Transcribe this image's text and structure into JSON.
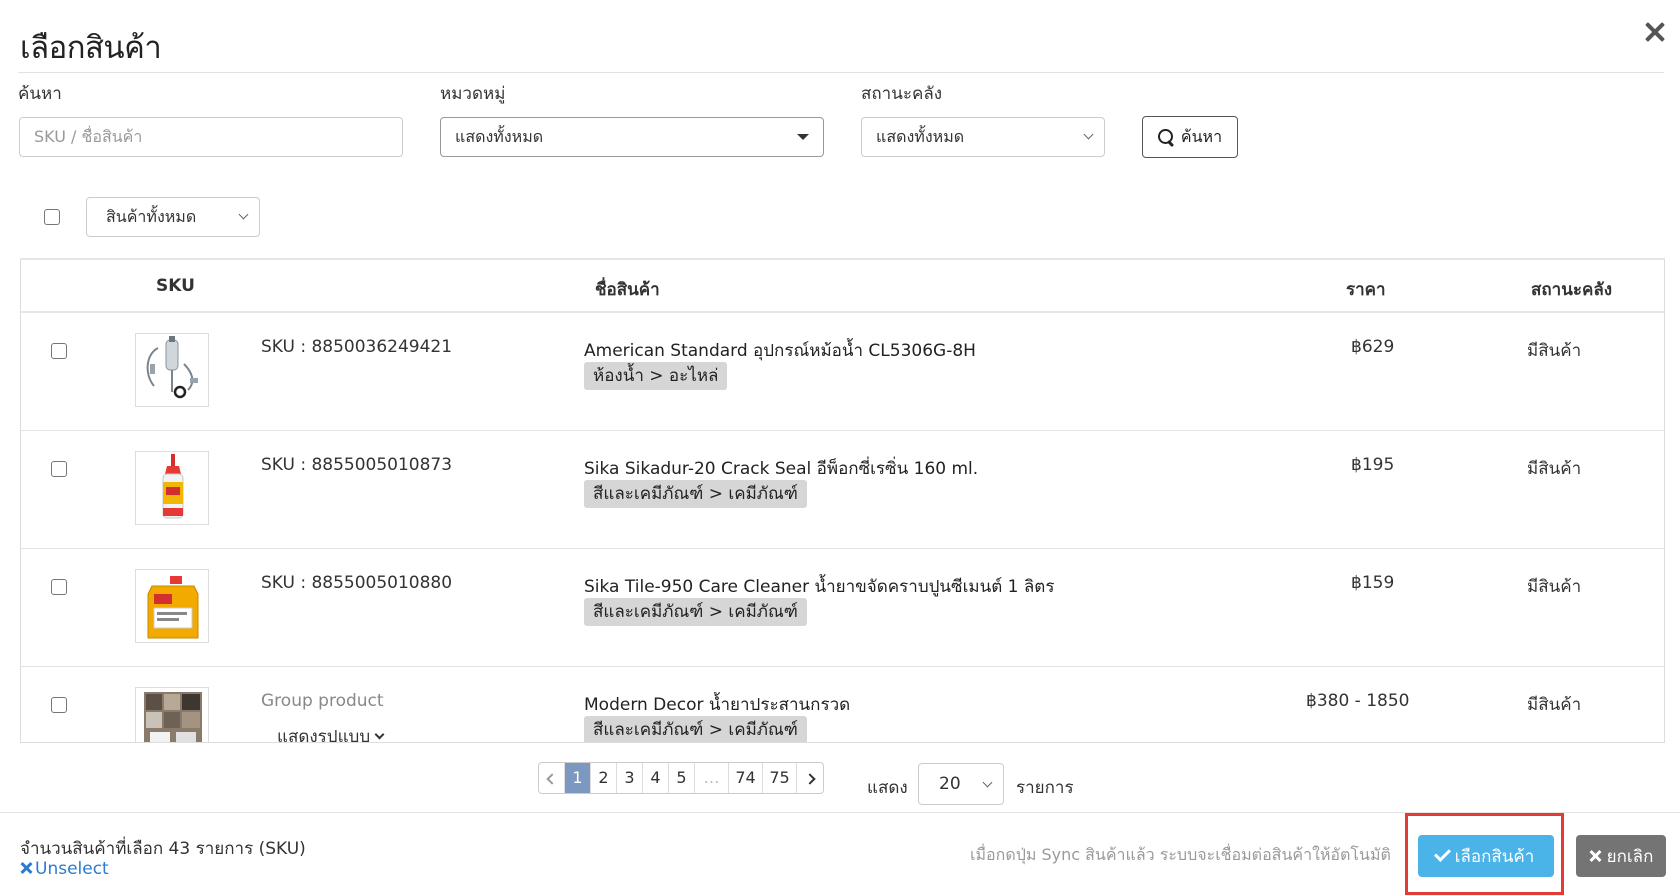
{
  "modal": {
    "title": "เลือกสินค้า"
  },
  "filters": {
    "search_label": "ค้นหา",
    "search_placeholder": "SKU / ชื่อสินค้า",
    "category_label": "หมวดหมู่",
    "category_value": "แสดงทั้งหมด",
    "stock_label": "สถานะคลัง",
    "stock_value": "แสดงทั้งหมด",
    "search_button": "ค้นหา"
  },
  "bulk": {
    "filter_value": "สินค้าทั้งหมด"
  },
  "table": {
    "headers": {
      "sku": "SKU",
      "name": "ชื่อสินค้า",
      "price": "ราคา",
      "stock": "สถานะคลัง"
    },
    "rows": [
      {
        "sku": "SKU : 8850036249421",
        "name": "American Standard อุปกรณ์หม้อน้ำ CL5306G-8H",
        "category": "ห้องน้ำ > อะไหล่",
        "price": "฿629",
        "stock": "มีสินค้า"
      },
      {
        "sku": "SKU : 8855005010873",
        "name": "Sika Sikadur-20 Crack Seal อีพ็อกซี่เรซิ่น 160 ml.",
        "category": "สีและเคมีภัณฑ์ > เคมีภัณฑ์",
        "price": "฿195",
        "stock": "มีสินค้า"
      },
      {
        "sku": "SKU : 8855005010880",
        "name": "Sika Tile-950 Care Cleaner น้ำยาขจัดคราบปูนซีเมนต์ 1 ลิตร",
        "category": "สีและเคมีภัณฑ์ > เคมีภัณฑ์",
        "price": "฿159",
        "stock": "มีสินค้า"
      },
      {
        "sku": "Group product",
        "variant_link": "แสดงรูปแบบ",
        "name": "Modern Decor น้ำยาประสานกรวด",
        "category": "สีและเคมีภัณฑ์ > เคมีภัณฑ์",
        "price": "฿380 - 1850",
        "stock": "มีสินค้า"
      }
    ]
  },
  "pagination": {
    "pages": [
      "1",
      "2",
      "3",
      "4",
      "5",
      "…",
      "74",
      "75"
    ],
    "current": "1",
    "show_label": "แสดง",
    "per_page": "20",
    "items_label": "รายการ"
  },
  "footer": {
    "selected_count": "จำนวนสินค้าที่เลือก 43 รายการ (SKU)",
    "unselect": "Unselect",
    "hint": "เมื่อกดปุ่ม Sync สินค้าแล้ว ระบบจะเชื่อมต่อสินค้าให้อัตโนมัติ",
    "select_button": "เลือกสินค้า",
    "cancel_button": "ยกเลิก"
  },
  "colors": {
    "primary_button": "#4ab3e8",
    "cancel_button": "#747474",
    "highlight_box": "#e53935",
    "link": "#2a7bd1",
    "active_page": "#7d98c0"
  },
  "icons": {
    "close": "close-icon",
    "search": "magnifier-icon",
    "check": "check-icon",
    "cancel": "x-icon",
    "unselect": "x-icon",
    "prev": "chevron-left-icon",
    "next": "chevron-right-icon",
    "dropdown": "chevron-down-icon"
  }
}
